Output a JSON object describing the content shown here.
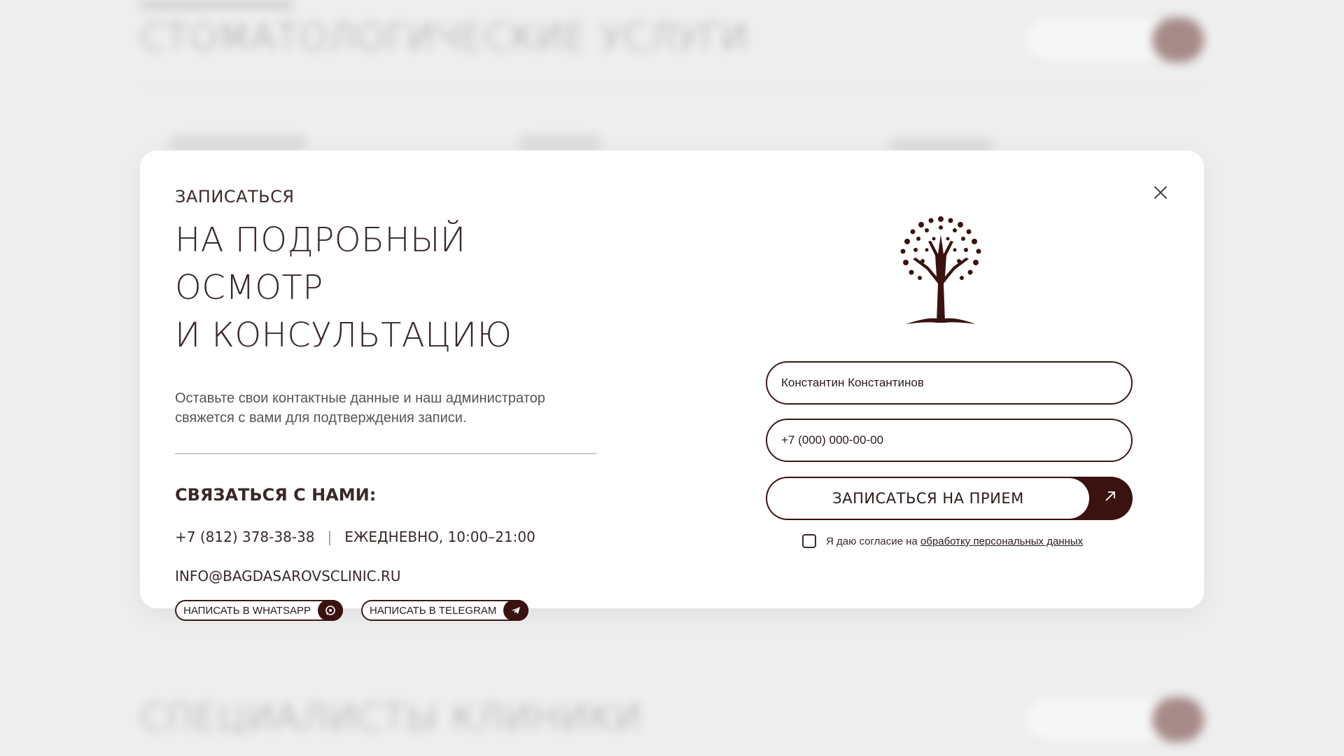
{
  "background": {
    "services_heading": "СТОМАТОЛОГИЧЕСКИЕ УСЛУГИ",
    "specialists_heading": "СПЕЦИАЛИСТЫ КЛИНИКИ"
  },
  "modal": {
    "kicker": "ЗАПИСАТЬСЯ",
    "title_line1": "НА ПОДРОБНЫЙ ОСМОТР",
    "title_line2": "И КОНСУЛЬТАЦИЮ",
    "description": "Оставьте свои контактные данные и наш администратор свяжется с вами для подтверждения записи.",
    "contact_heading": "СВЯЗАТЬСЯ С НАМИ:",
    "phone": "+7 (812) 378-38-38",
    "separator": "|",
    "hours": "ЕЖЕДНЕВНО, 10:00–21:00",
    "email": "INFO@BAGDASAROVSCLINIC.RU",
    "whatsapp_label": "НАПИСАТЬ В WHATSAPP",
    "telegram_label": "НАПИСАТЬ В TELEGRAM",
    "form": {
      "name_value": "Константин Константинов",
      "phone_placeholder": "+7 (000) 000-00-00",
      "submit_label": "ЗАПИСАТЬСЯ НА ПРИЕМ",
      "consent_text": "Я даю согласие на",
      "consent_link": "обработку персональных данных"
    }
  },
  "colors": {
    "brand_dark": "#3a1210",
    "modal_bg": "#ffffff",
    "overlay_bg": "#eeeeee"
  },
  "icons": {
    "close": "close-icon",
    "whatsapp": "whatsapp-icon",
    "telegram": "telegram-icon",
    "arrow": "arrow-up-right-icon",
    "logo": "tree-logo"
  }
}
